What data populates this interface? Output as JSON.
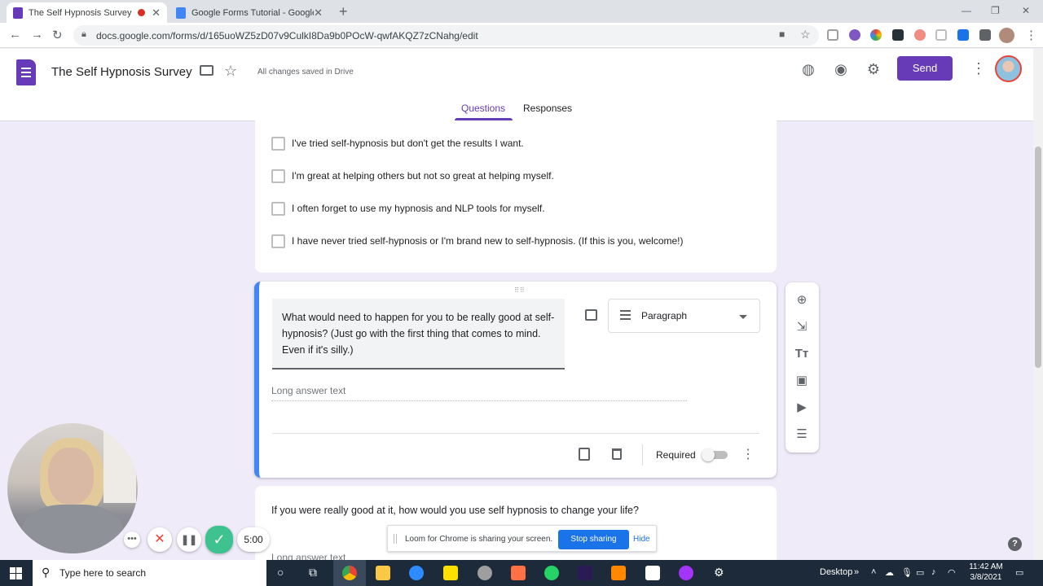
{
  "browser": {
    "tabs": [
      {
        "title": "The Self Hypnosis Survey - G",
        "close": "✕"
      },
      {
        "title": "Google Forms Tutorial - Google I",
        "close": "✕"
      }
    ],
    "new_tab": "+",
    "url": "docs.google.com/forms/d/165uoWZ5zD07v9CulkI8Da9b0POcW-qwfAKQZ7zCNahg/edit"
  },
  "form_header": {
    "title": "The Self Hypnosis Survey",
    "save_status": "All changes saved in Drive",
    "send_label": "Send",
    "tabs": [
      {
        "label": "Questions",
        "active": true
      },
      {
        "label": "Responses",
        "active": false
      }
    ]
  },
  "prev_question": {
    "options": [
      "I've tried self-hypnosis but don't get the results I want.",
      "I'm great at helping others but not so great at helping myself.",
      "I often forget to use my hypnosis and NLP tools for myself.",
      "I have never tried self-hypnosis or I'm brand new to self-hypnosis. (If this is you, welcome!)"
    ]
  },
  "active_question": {
    "text": "What would need to happen for you to be really good at self-hypnosis? (Just go with the first thing that comes to mind. Even if it's silly.)",
    "type": "Paragraph",
    "answer_placeholder": "Long answer text",
    "required_label": "Required",
    "required": false
  },
  "next_question": {
    "text": "If you were really good at it, how would you use self hypnosis to change your life?",
    "answer_placeholder": "Long answer text"
  },
  "loom": {
    "timer": "5:00",
    "share_message": "Loom for Chrome is sharing your screen.",
    "stop_label": "Stop sharing",
    "hide_label": "Hide"
  },
  "taskbar": {
    "search_placeholder": "Type here to search",
    "desktop_label": "Desktop",
    "time": "11:42 AM",
    "date": "3/8/2021"
  },
  "colors": {
    "forms_purple": "#673ab7",
    "active_card_accent": "#4285f4",
    "page_background": "#f0ebf8"
  }
}
